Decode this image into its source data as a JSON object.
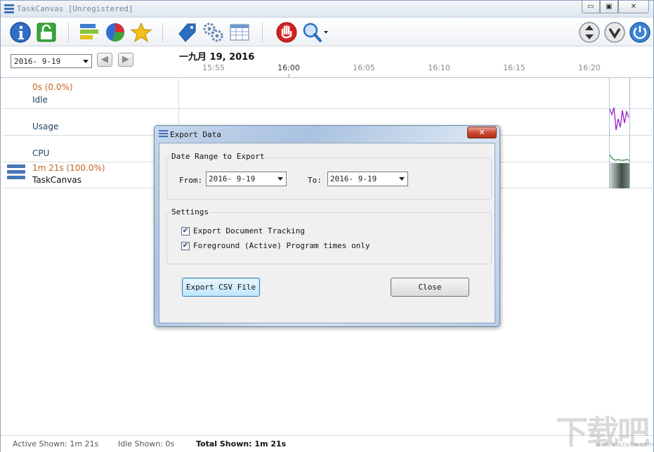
{
  "window": {
    "title": "TaskCanvas [Unregistered]",
    "min_label": "▭",
    "max_label": "▣",
    "close_label": "✕"
  },
  "toolbar": {
    "icons": [
      "info-icon",
      "unlock-icon",
      "bars-icon",
      "pie-chart-icon",
      "star-icon",
      "tag-icon",
      "gears-icon",
      "table-icon",
      "stop-hand-icon",
      "search-icon",
      "expand-collapse-icon",
      "chevron-down-icon",
      "power-icon"
    ]
  },
  "timeline": {
    "date_value": "2016- 9-19",
    "big_date": "一九月 19, 2016",
    "ticks": [
      "15:55",
      "16:00",
      "16:05",
      "16:10",
      "16:15",
      "16:20"
    ],
    "major_tick": "16:00"
  },
  "rows": {
    "idle_time": "0s (0.0%)",
    "idle_label": "Idle",
    "usage_label": "Usage",
    "cpu_label": "CPU",
    "app_time": "1m 21s (100.0%)",
    "app_label": "TaskCanvas"
  },
  "status": {
    "active_shown": "Active Shown: 1m 21s",
    "idle_shown": "Idle Shown: 0s",
    "total_shown": "Total Shown: 1m 21s"
  },
  "dialog": {
    "title": "Export Data",
    "close_label": "✕",
    "date_group_title": "Date Range to Export",
    "from_label": "From:",
    "from_value": "2016- 9-19",
    "to_label": "To:",
    "to_value": "2016- 9-19",
    "settings_group_title": "Settings",
    "opt1_label": "Export Document Tracking",
    "opt1_checked": true,
    "opt2_label": "Foreground (Active) Program times only",
    "opt2_checked": true,
    "export_button": "Export CSV File",
    "close_button": "Close"
  },
  "colors": {
    "accent": "#3f6fb5",
    "idle_time_color": "#c8641e",
    "app_time_color": "#c8641e",
    "usage_line": "#9b1ec8",
    "cpu_line": "#2e8b3a"
  }
}
